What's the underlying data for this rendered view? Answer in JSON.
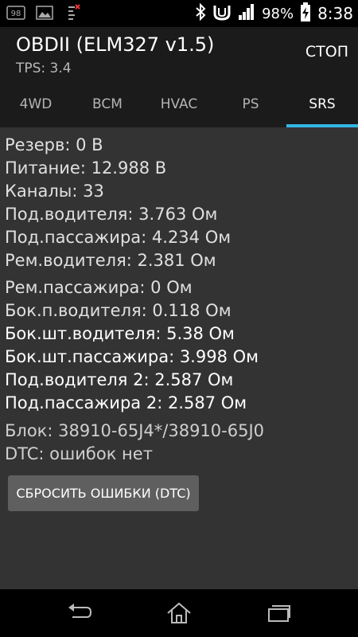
{
  "status_bar": {
    "notif_icons": [
      "notification-count-icon",
      "image-icon",
      "debug-icon"
    ],
    "notification_count": "98",
    "battery_percent": "98%",
    "time": "8:38"
  },
  "header": {
    "title": "OBDII (ELM327 v1.5)",
    "subtitle": "TPS: 3.4",
    "stop_label": "СТОП"
  },
  "tabs": [
    {
      "label": "4WD",
      "active": false
    },
    {
      "label": "BCM",
      "active": false
    },
    {
      "label": "HVAC",
      "active": false
    },
    {
      "label": "PS",
      "active": false
    },
    {
      "label": "SRS",
      "active": true
    }
  ],
  "lines": [
    "Резерв: 0 В",
    "Питание: 12.988 В",
    "Каналы: 33",
    "Под.водителя: 3.763 Ом",
    "Под.пассажира: 4.234 Ом",
    "Рем.водителя: 2.381 Ом",
    "Рем.пассажира: 0 Ом",
    "Бок.п.водителя: 0.118 Ом",
    "Бок.шт.водителя: 5.38 Ом",
    "Бок.шт.пассажира: 3.998 Ом",
    "Под.водителя 2: 2.587 Ом",
    "Под.пассажира 2: 2.587 Ом",
    "Блок: 38910-65J4*/38910-65J0",
    "DTC: ошибок нет"
  ],
  "reset_button_label": "СБРОСИТЬ ОШИБКИ (DTC)",
  "colors": {
    "accent": "#33b5e5",
    "content_bg": "#333333",
    "header_bg": "#1b1b1b"
  }
}
